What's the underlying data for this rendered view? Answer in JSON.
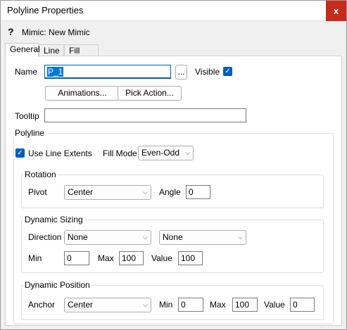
{
  "window": {
    "title": "Polyline Properties",
    "close": "x"
  },
  "mimic": {
    "help": "?",
    "label": "Mimic: New Mimic"
  },
  "tabs": [
    "General",
    "Line",
    "Fill"
  ],
  "general": {
    "name_label": "Name",
    "name_value": "P_1",
    "browse": "...",
    "visible_label": "Visible",
    "visible_checked": true,
    "animations": "Animations...",
    "pick_action": "Pick Action...",
    "tooltip_label": "Tooltip",
    "tooltip_value": ""
  },
  "polyline": {
    "title": "Polyline",
    "use_line_extents": "Use Line Extents",
    "use_line_extents_checked": true,
    "fill_mode_label": "Fill Mode",
    "fill_mode": "Even-Odd"
  },
  "rotation": {
    "title": "Rotation",
    "pivot_label": "Pivot",
    "pivot": "Center",
    "angle_label": "Angle",
    "angle": "0"
  },
  "dynamic_sizing": {
    "title": "Dynamic Sizing",
    "direction_label": "Direction",
    "direction1": "None",
    "direction2": "None",
    "min_label": "Min",
    "min": "0",
    "max_label": "Max",
    "max": "100",
    "value_label": "Value",
    "value": "100"
  },
  "dynamic_position": {
    "title": "Dynamic Position",
    "anchor_label": "Anchor",
    "anchor": "Center",
    "min_label": "Min",
    "min": "0",
    "max_label": "Max",
    "max": "100",
    "value_label": "Value",
    "value": "0"
  }
}
